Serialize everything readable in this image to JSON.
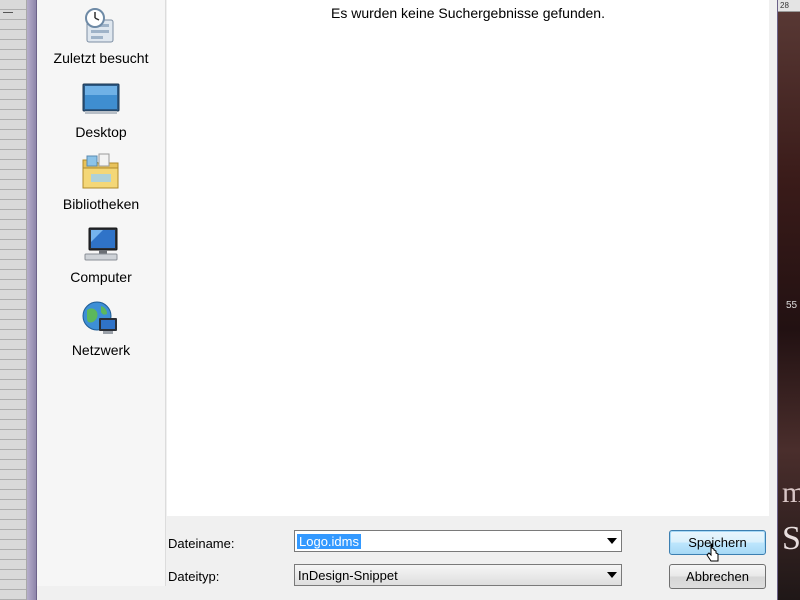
{
  "dialog": {
    "no_results_text": "Es wurden keine Suchergebnisse gefunden."
  },
  "sidebar": {
    "items": [
      {
        "label": "Zuletzt besucht",
        "icon": "recent-places-icon"
      },
      {
        "label": "Desktop",
        "icon": "desktop-icon"
      },
      {
        "label": "Bibliotheken",
        "icon": "libraries-folder-icon"
      },
      {
        "label": "Computer",
        "icon": "computer-icon"
      },
      {
        "label": "Netzwerk",
        "icon": "network-globe-icon"
      }
    ]
  },
  "form": {
    "filename_label": "Dateiname:",
    "filename_value": "Logo.idms",
    "filetype_label": "Dateityp:",
    "filetype_value": "InDesign-Snippet"
  },
  "buttons": {
    "save_label": "Speichern",
    "cancel_label": "Abbrechen"
  },
  "background": {
    "right_ruler_number": "28",
    "right_side_number": "55"
  },
  "colors": {
    "selection": "#3399ff",
    "frame": "#8e86aa"
  }
}
